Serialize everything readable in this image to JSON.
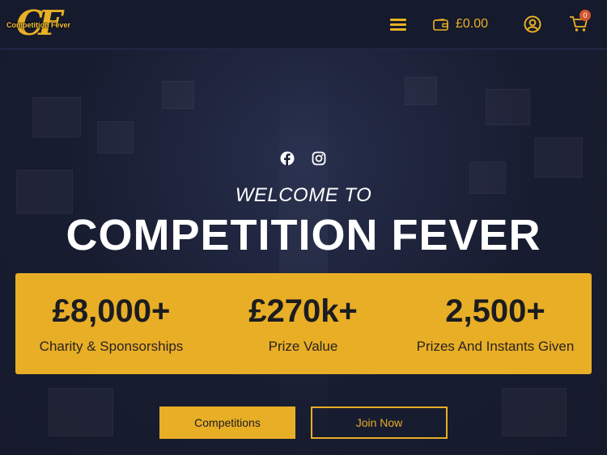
{
  "header": {
    "logo_mark": "CF",
    "logo_name": "Competition Fever",
    "wallet_amount": "£0.00",
    "cart_count": "0"
  },
  "hero": {
    "welcome": "WELCOME TO",
    "title": "COMPETITION FEVER",
    "stats": [
      {
        "value": "£8,000+",
        "label": "Charity & Sponsorships"
      },
      {
        "value": "£270k+",
        "label": "Prize Value"
      },
      {
        "value": "2,500+",
        "label": "Prizes And Instants Given"
      }
    ],
    "buttons": {
      "competitions": "Competitions",
      "join": "Join Now"
    }
  },
  "icons": {
    "menu": "hamburger-icon",
    "wallet": "wallet-icon",
    "account": "user-circle-icon",
    "cart": "cart-icon",
    "facebook": "facebook-icon",
    "instagram": "instagram-icon"
  },
  "colors": {
    "accent": "#e8ae26",
    "header_bg": "#151a2c",
    "page_bg": "#1b2036",
    "badge": "#d2562e"
  }
}
